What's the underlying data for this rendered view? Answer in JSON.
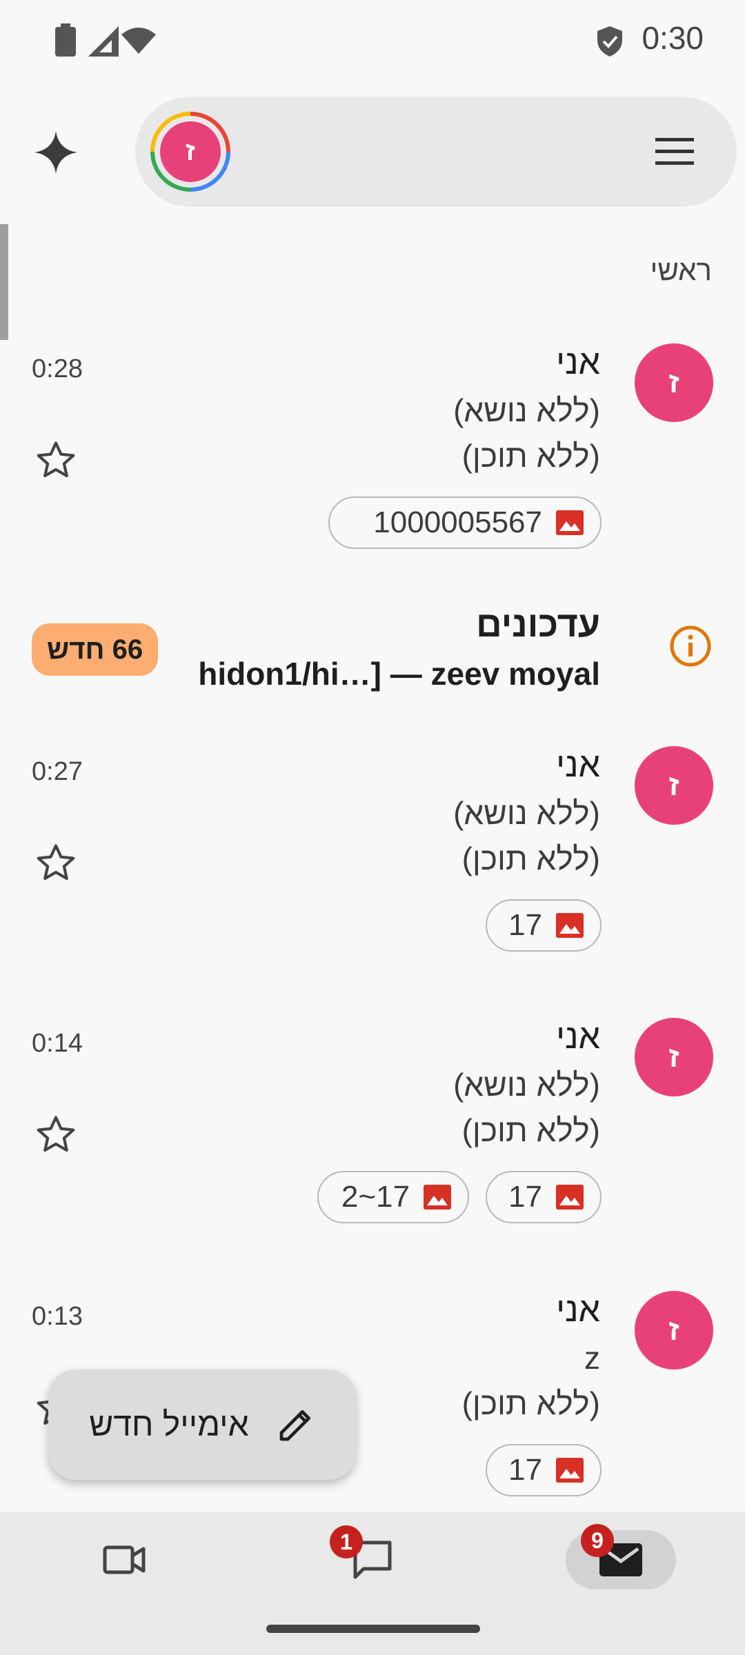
{
  "status_bar": {
    "time": "0:30"
  },
  "account": {
    "initial": "ז"
  },
  "section": {
    "label": "ראשי"
  },
  "emails": [
    {
      "initial": "ז",
      "sender": "אני",
      "subject": "(ללא נושא)",
      "preview": "(ללא תוכן)",
      "time": "0:28",
      "attachments": [
        "1000005567"
      ]
    },
    {
      "initial": "ז",
      "sender": "אני",
      "subject": "(ללא נושא)",
      "preview": "(ללא תוכן)",
      "time": "0:27",
      "attachments": [
        "17"
      ]
    },
    {
      "initial": "ז",
      "sender": "אני",
      "subject": "(ללא נושא)",
      "preview": "(ללא תוכן)",
      "time": "0:14",
      "attachments": [
        "17",
        "17~2"
      ]
    },
    {
      "initial": "ז",
      "sender": "אני",
      "subject": "z",
      "preview": "(ללא תוכן)",
      "time": "0:13",
      "attachments": [
        "17"
      ]
    }
  ],
  "updates": {
    "title": "עדכונים",
    "senders": "hidon1/hi…] — zeev moyal",
    "badge": "66 חדש"
  },
  "compose": {
    "label": "אימייל חדש"
  },
  "bottom_nav": {
    "chat_badge": "1",
    "mail_badge": "9"
  },
  "colors": {
    "avatar": "#e8417a",
    "badge_red": "#c5221f",
    "new_badge": "#fbad72",
    "info_orange": "#e37400"
  }
}
